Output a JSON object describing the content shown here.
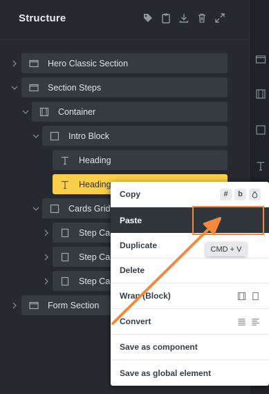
{
  "header": {
    "title": "Structure"
  },
  "tree": {
    "items": [
      {
        "label": "Hero Classic Section",
        "icon": "section-icon"
      },
      {
        "label": "Section Steps",
        "icon": "section-icon"
      },
      {
        "label": "Container",
        "icon": "container-icon"
      },
      {
        "label": "Intro Block",
        "icon": "block-icon"
      },
      {
        "label": "Heading",
        "icon": "text-icon"
      },
      {
        "label": "Heading",
        "icon": "text-icon",
        "active": true
      },
      {
        "label": "Cards Grid",
        "icon": "block-icon"
      },
      {
        "label": "Step Card",
        "icon": "card-icon"
      },
      {
        "label": "Step Card",
        "icon": "card-icon"
      },
      {
        "label": "Step Card",
        "icon": "card-icon"
      },
      {
        "label": "Form Section",
        "icon": "section-icon"
      }
    ]
  },
  "context_menu": {
    "copy": "Copy",
    "copy_badges": [
      "#",
      "b",
      "drop-icon"
    ],
    "paste": "Paste",
    "duplicate": "Duplicate",
    "delete": "Delete",
    "wrap": "Wrap (Block)",
    "convert": "Convert",
    "save_component": "Save as component",
    "save_global": "Save as global element"
  },
  "tooltip": {
    "text": "CMD + V"
  },
  "colors": {
    "accent": "#f8cf4b",
    "annotation": "#f5883a"
  }
}
